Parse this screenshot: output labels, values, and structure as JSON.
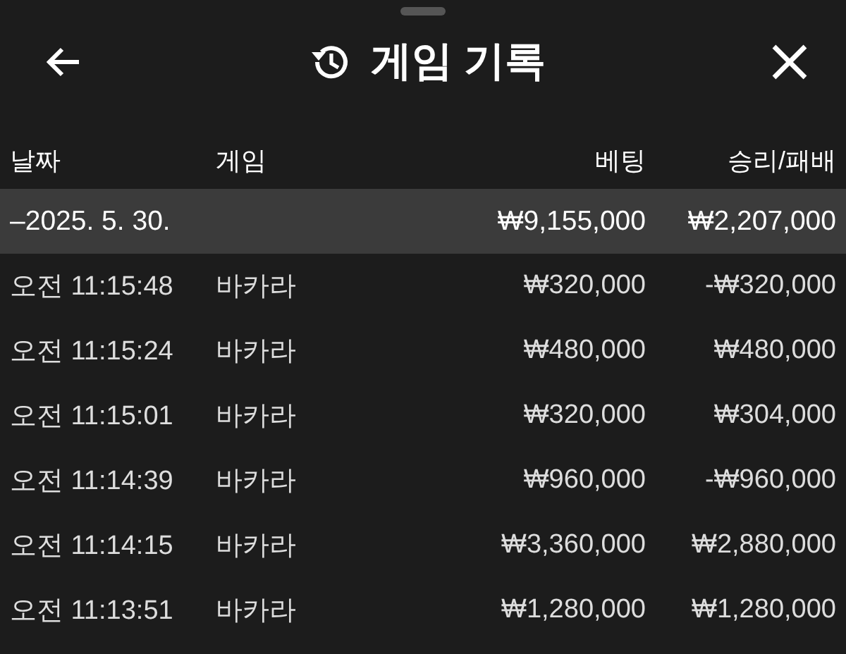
{
  "header": {
    "title": "게임 기록"
  },
  "table": {
    "columns": [
      "날짜",
      "게임",
      "베팅",
      "승리/패배"
    ],
    "group": {
      "date": "–2025. 5. 30.",
      "bet": "₩9,155,000",
      "result": "₩2,207,000"
    },
    "rows": [
      {
        "time": "오전 11:15:48",
        "game": "바카라",
        "bet": "₩320,000",
        "result": "-₩320,000"
      },
      {
        "time": "오전 11:15:24",
        "game": "바카라",
        "bet": "₩480,000",
        "result": "₩480,000"
      },
      {
        "time": "오전 11:15:01",
        "game": "바카라",
        "bet": "₩320,000",
        "result": "₩304,000"
      },
      {
        "time": "오전 11:14:39",
        "game": "바카라",
        "bet": "₩960,000",
        "result": "-₩960,000"
      },
      {
        "time": "오전 11:14:15",
        "game": "바카라",
        "bet": "₩3,360,000",
        "result": "₩2,880,000"
      },
      {
        "time": "오전 11:13:51",
        "game": "바카라",
        "bet": "₩1,280,000",
        "result": "₩1,280,000"
      }
    ]
  }
}
